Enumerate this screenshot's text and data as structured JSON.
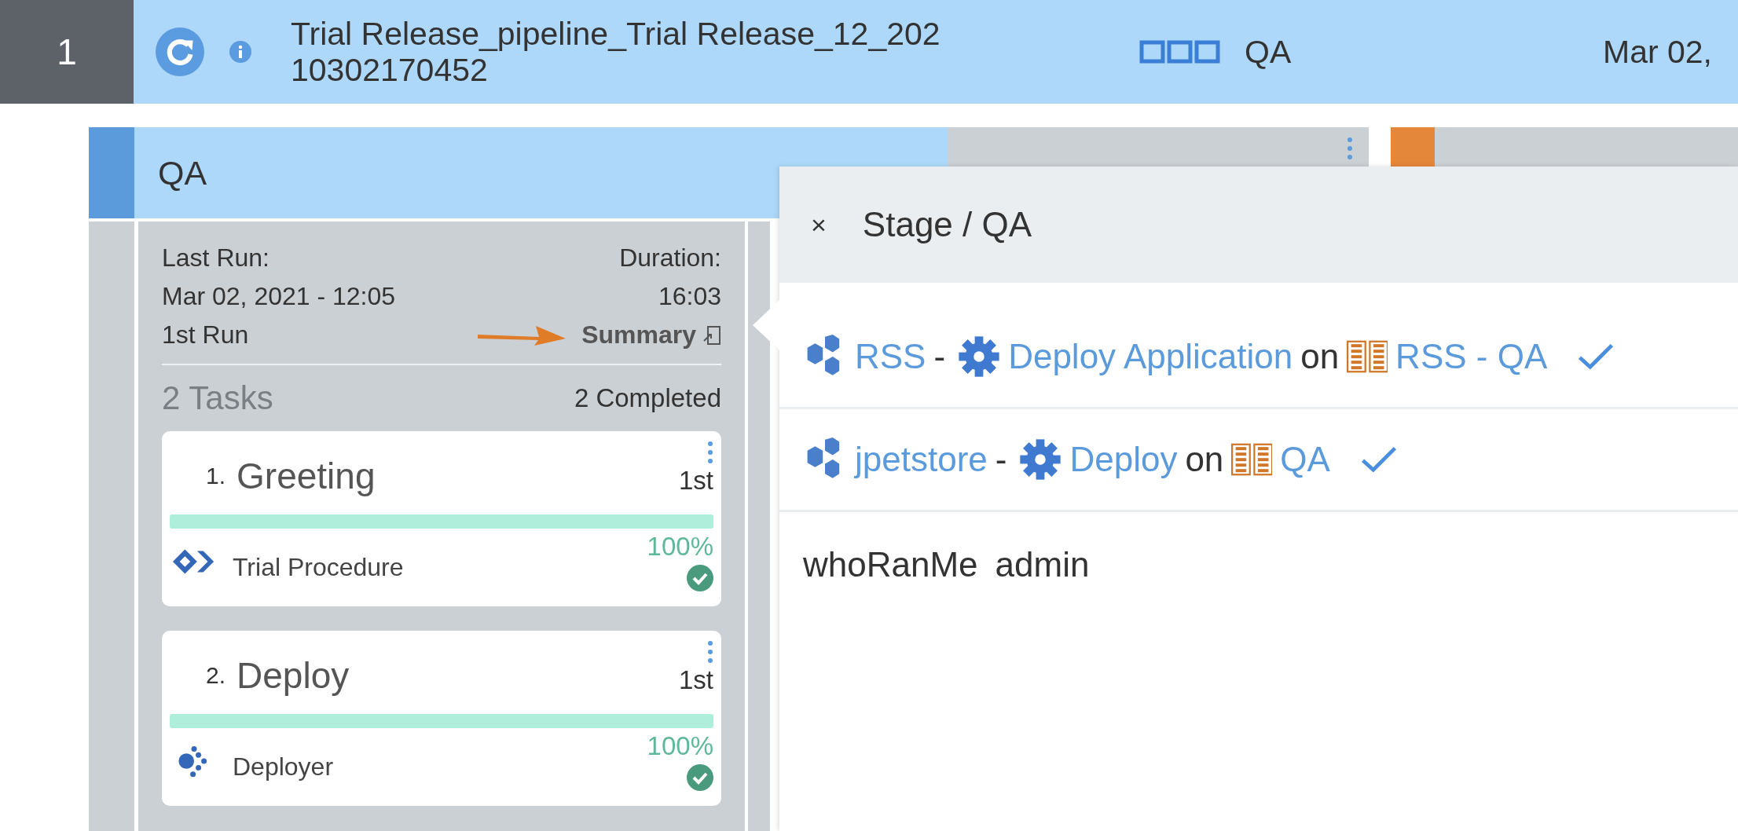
{
  "run": {
    "number": "1",
    "title_lines": [
      "Trial Release_pipeline_Trial Release_12_202",
      "10302170452"
    ],
    "stage": "QA",
    "date": "Mar 02,"
  },
  "stage": {
    "name": "QA",
    "last_run_label": "Last Run:",
    "last_run_date": "Mar 02, 2021 - 12:05",
    "run_ordinal": "1st Run",
    "duration_label": "Duration:",
    "duration": "16:03",
    "summary": "Summary",
    "tasks_count": "2 Tasks",
    "completed_count": "2 Completed",
    "tasks": [
      {
        "number": "1.",
        "name": "Greeting",
        "attempt": "1st",
        "level": 1,
        "kind": "procedure",
        "subtitle": "Trial Procedure",
        "percent": "100%",
        "completed": true
      },
      {
        "number": "2.",
        "name": "Deploy",
        "attempt": "1st",
        "level": 1,
        "kind": "deployer",
        "subtitle": "Deployer",
        "percent": "100%",
        "completed": true
      }
    ]
  },
  "popup": {
    "close": "×",
    "title": "Stage / QA",
    "rows": [
      {
        "application": "RSS",
        "separator": "-",
        "process": "Deploy Application",
        "connector": "on",
        "environment": "RSS - QA",
        "success": true
      },
      {
        "application": "jpetstore",
        "separator": "-",
        "process": "Deploy",
        "connector": "on",
        "environment": "QA",
        "success": true
      }
    ],
    "parameters": [
      {
        "name": "whoRanMe",
        "value": "admin"
      }
    ]
  }
}
